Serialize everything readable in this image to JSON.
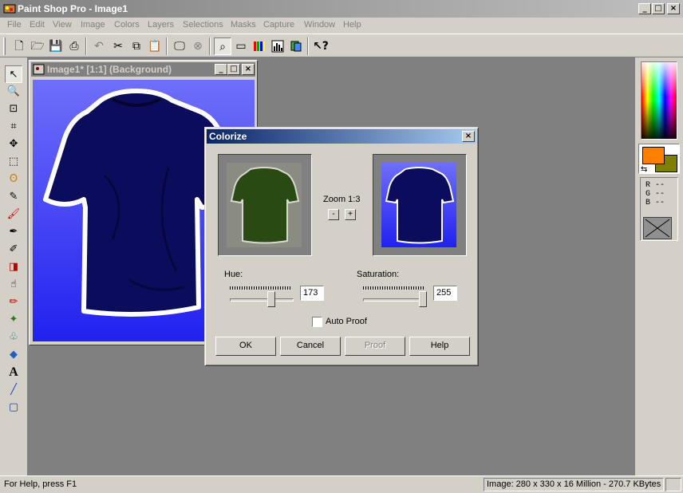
{
  "app": {
    "title": "Paint Shop Pro - Image1",
    "controls": {
      "minimize": "_",
      "maximize": "□",
      "close": "×"
    }
  },
  "menu": [
    "File",
    "Edit",
    "View",
    "Image",
    "Colors",
    "Layers",
    "Selections",
    "Masks",
    "Capture",
    "Window",
    "Help"
  ],
  "toolbar_icons": [
    "new-icon",
    "open-icon",
    "save-icon",
    "print-icon",
    "undo-icon",
    "cut-icon",
    "copy-icon",
    "paste-icon",
    "full-screen-preview-icon",
    "browse-icon",
    "overview-icon",
    "tool-options-icon",
    "color-palette-icon",
    "histogram-icon",
    "layer-palette-icon",
    "context-help-icon"
  ],
  "tools": [
    "arrow",
    "zoom",
    "deformation",
    "crop",
    "mover",
    "selection",
    "freehand",
    "dropper",
    "paintbrush",
    "clone",
    "color-replacer",
    "retouch",
    "scratch-remover",
    "eraser",
    "picture-tube",
    "airbrush",
    "flood-fill",
    "text",
    "draw",
    "preset-shapes"
  ],
  "image_window": {
    "title": "Image1* [1:1] (Background)"
  },
  "palette": {
    "foreground_color": "#ff8000",
    "background_color": "#808000",
    "r": "R --",
    "g": "G --",
    "b": "B --"
  },
  "dialog": {
    "title": "Colorize",
    "zoom_label": "Zoom 1:3",
    "zoom_out": "-",
    "zoom_in": "+",
    "hue_label": "Hue:",
    "hue_value": "173",
    "hue_fraction": 0.678,
    "saturation_label": "Saturation:",
    "saturation_value": "255",
    "saturation_fraction": 1.0,
    "auto_proof_label": "Auto Proof",
    "auto_proof_checked": false,
    "ok": "OK",
    "cancel": "Cancel",
    "proof": "Proof",
    "help": "Help"
  },
  "status": {
    "help_text": "For Help, press F1",
    "image_info": "Image:  280 x 330 x 16 Million - 270.7 KBytes"
  }
}
